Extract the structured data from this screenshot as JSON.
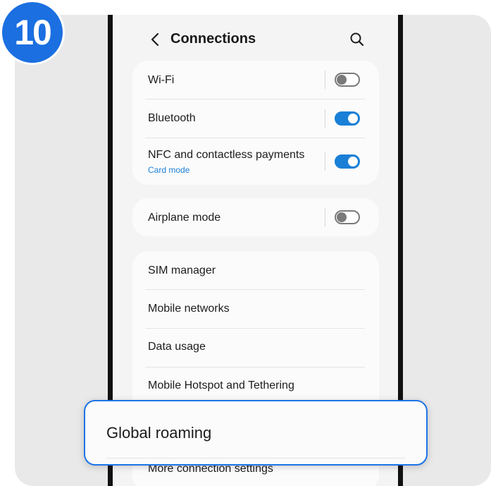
{
  "step": {
    "number": "10"
  },
  "header": {
    "title": "Connections",
    "back_icon": "chevron-left-icon",
    "search_icon": "search-icon"
  },
  "groups": [
    {
      "items": [
        {
          "label": "Wi-Fi",
          "toggle": "off"
        },
        {
          "label": "Bluetooth",
          "toggle": "on"
        },
        {
          "label": "NFC and contactless payments",
          "sublabel": "Card mode",
          "toggle": "on"
        }
      ]
    },
    {
      "items": [
        {
          "label": "Airplane mode",
          "toggle": "off"
        }
      ]
    },
    {
      "items": [
        {
          "label": "SIM manager"
        },
        {
          "label": "Mobile networks"
        },
        {
          "label": "Data usage"
        },
        {
          "label": "Mobile Hotspot and Tethering"
        },
        {
          "label": "More connection settings"
        }
      ]
    }
  ],
  "highlight": {
    "label": "Global roaming"
  },
  "colors": {
    "accent": "#1a7fd6",
    "badge": "#1b6fe0",
    "highlight_border": "#1d74e6",
    "background": "#e9e9e9",
    "screen": "#f4f4f4"
  }
}
